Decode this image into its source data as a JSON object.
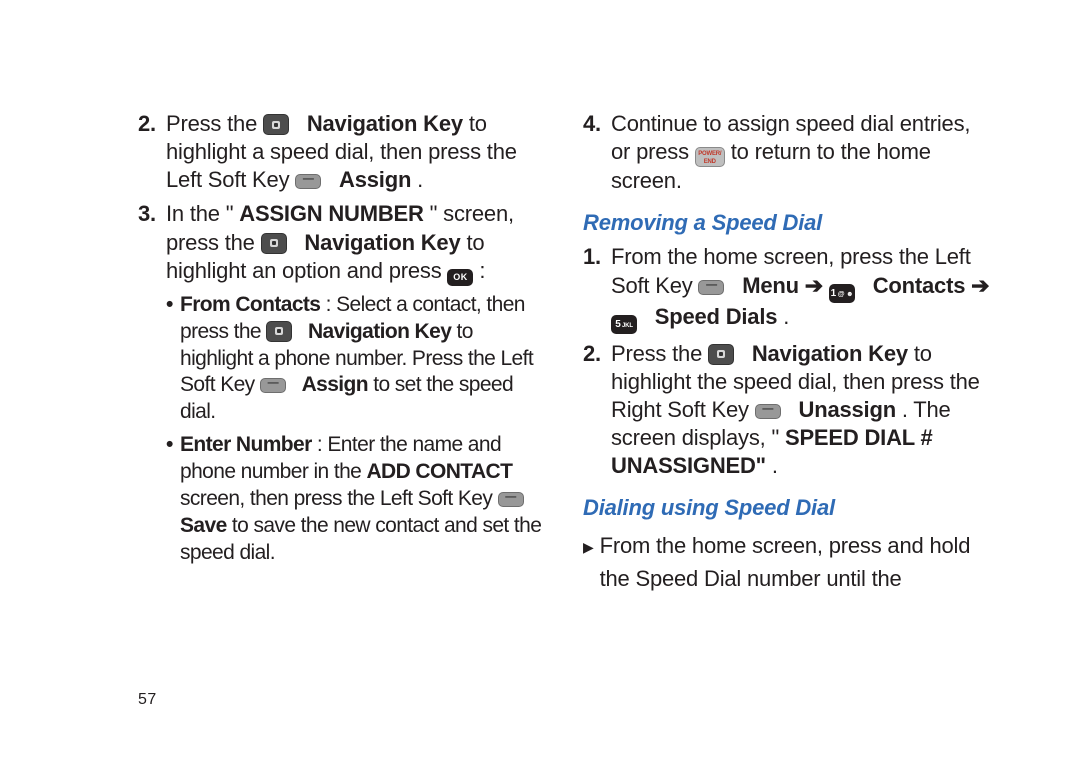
{
  "pageNumber": "57",
  "left": {
    "step2": {
      "num": "2.",
      "t1": "Press the ",
      "navKey": "Navigation Key",
      "t2": " to highlight a speed dial, then press the Left Soft Key ",
      "assign": "Assign",
      "t3": "."
    },
    "step3": {
      "num": "3.",
      "t1": "In the \"",
      "assignNumber": "ASSIGN NUMBER",
      "t2": "\" screen, press the ",
      "navKey": "Navigation Key",
      "t3": " to highlight an option and press ",
      "ok": "OK",
      "t4": ":"
    },
    "sub1": {
      "label": "From Contacts",
      "t1": ": Select a contact, then press the ",
      "navKey": "Navigation Key",
      "t2": " to highlight a phone number. Press  the Left Soft Key ",
      "assign": "Assign",
      "t3": " to set the speed dial."
    },
    "sub2": {
      "label": "Enter Number",
      "t1": ": Enter the name and phone number in the ",
      "addContact": "ADD CONTACT",
      "t2": " screen, then press the Left Soft Key ",
      "save": "Save",
      "t3": " to save the new contact and set the speed dial."
    }
  },
  "right": {
    "step4": {
      "num": "4.",
      "t1": "Continue to assign speed dial entries, or press ",
      "end": "POWER/\nEND",
      "t2": " to return to the home screen."
    },
    "removeHead": "Removing a Speed Dial",
    "r1": {
      "num": "1.",
      "t1": "From the home screen, press the Left Soft Key ",
      "menu": "Menu",
      "arrow1": " ➔ ",
      "key1": "1 @ ☻",
      "contacts": "Contacts",
      "arrow2": " ➔ ",
      "key5": "5 JKL",
      "speedDials": "Speed Dials",
      "t2": "."
    },
    "r2": {
      "num": "2.",
      "t1": "Press the ",
      "navKey": "Navigation Key",
      "t2": " to highlight the speed dial, then press the Right Soft Key ",
      "unassign": "Unassign",
      "t3": ". The screen displays, \"",
      "msg": "SPEED DIAL # UNASSIGNED\"",
      "t4": "."
    },
    "dialHead": "Dialing using Speed Dial",
    "d1": {
      "tri": "▶",
      "t1": "From the home screen, press and hold the Speed Dial number until the"
    }
  }
}
